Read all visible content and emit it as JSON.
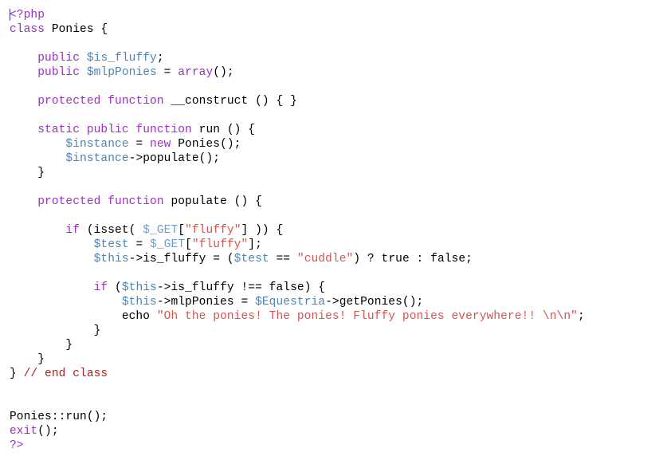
{
  "editor": {
    "language": "PHP",
    "caret_visible": true,
    "background_color": "#ffffff",
    "foreground_color": "#000000"
  },
  "theme": {
    "keyword": "#9B30C0",
    "variable": "#4E84B4",
    "superglobal": "#6E9FCC",
    "string": "#D9534F",
    "comment": "#B0201E",
    "plain": "#000000"
  },
  "code": {
    "lines": [
      {
        "indent": 0,
        "tokens": [
          {
            "t": "<?php",
            "c": "tag"
          }
        ]
      },
      {
        "indent": 0,
        "tokens": [
          {
            "t": "class",
            "c": "kw"
          },
          {
            "t": " Ponies {",
            "c": "plain"
          }
        ]
      },
      {
        "indent": 0,
        "tokens": []
      },
      {
        "indent": 1,
        "tokens": [
          {
            "t": "public",
            "c": "kw"
          },
          {
            "t": " ",
            "c": "plain"
          },
          {
            "t": "$is_fluffy",
            "c": "var"
          },
          {
            "t": ";",
            "c": "plain"
          }
        ]
      },
      {
        "indent": 1,
        "tokens": [
          {
            "t": "public",
            "c": "kw"
          },
          {
            "t": " ",
            "c": "plain"
          },
          {
            "t": "$mlpPonies",
            "c": "var"
          },
          {
            "t": " = ",
            "c": "plain"
          },
          {
            "t": "array",
            "c": "kw"
          },
          {
            "t": "();",
            "c": "plain"
          }
        ]
      },
      {
        "indent": 0,
        "tokens": []
      },
      {
        "indent": 1,
        "tokens": [
          {
            "t": "protected function",
            "c": "kw"
          },
          {
            "t": " __construct () { }",
            "c": "plain"
          }
        ]
      },
      {
        "indent": 0,
        "tokens": []
      },
      {
        "indent": 1,
        "tokens": [
          {
            "t": "static public function",
            "c": "kw"
          },
          {
            "t": " run () {",
            "c": "plain"
          }
        ]
      },
      {
        "indent": 2,
        "tokens": [
          {
            "t": "$instance",
            "c": "var"
          },
          {
            "t": " = ",
            "c": "plain"
          },
          {
            "t": "new",
            "c": "kw"
          },
          {
            "t": " Ponies();",
            "c": "plain"
          }
        ]
      },
      {
        "indent": 2,
        "tokens": [
          {
            "t": "$instance",
            "c": "var"
          },
          {
            "t": "->populate();",
            "c": "plain"
          }
        ]
      },
      {
        "indent": 1,
        "tokens": [
          {
            "t": "}",
            "c": "plain"
          }
        ]
      },
      {
        "indent": 0,
        "tokens": []
      },
      {
        "indent": 1,
        "tokens": [
          {
            "t": "protected function",
            "c": "kw"
          },
          {
            "t": " populate () {",
            "c": "plain"
          }
        ]
      },
      {
        "indent": 0,
        "tokens": []
      },
      {
        "indent": 2,
        "tokens": [
          {
            "t": "if",
            "c": "kw"
          },
          {
            "t": " (isset( ",
            "c": "plain"
          },
          {
            "t": "$_GET",
            "c": "svar"
          },
          {
            "t": "[",
            "c": "plain"
          },
          {
            "t": "\"fluffy\"",
            "c": "str"
          },
          {
            "t": "] )) {",
            "c": "plain"
          }
        ]
      },
      {
        "indent": 3,
        "tokens": [
          {
            "t": "$test",
            "c": "var"
          },
          {
            "t": " = ",
            "c": "plain"
          },
          {
            "t": "$_GET",
            "c": "svar"
          },
          {
            "t": "[",
            "c": "plain"
          },
          {
            "t": "\"fluffy\"",
            "c": "str"
          },
          {
            "t": "];",
            "c": "plain"
          }
        ]
      },
      {
        "indent": 3,
        "tokens": [
          {
            "t": "$this",
            "c": "var"
          },
          {
            "t": "->is_fluffy = (",
            "c": "plain"
          },
          {
            "t": "$test",
            "c": "var"
          },
          {
            "t": " == ",
            "c": "plain"
          },
          {
            "t": "\"cuddle\"",
            "c": "str"
          },
          {
            "t": ") ? true : false;",
            "c": "plain"
          }
        ]
      },
      {
        "indent": 0,
        "tokens": []
      },
      {
        "indent": 3,
        "tokens": [
          {
            "t": "if",
            "c": "kw"
          },
          {
            "t": " (",
            "c": "plain"
          },
          {
            "t": "$this",
            "c": "var"
          },
          {
            "t": "->is_fluffy !== false) {",
            "c": "plain"
          }
        ]
      },
      {
        "indent": 4,
        "tokens": [
          {
            "t": "$this",
            "c": "var"
          },
          {
            "t": "->mlpPonies = ",
            "c": "plain"
          },
          {
            "t": "$Equestria",
            "c": "var"
          },
          {
            "t": "->getPonies();",
            "c": "plain"
          }
        ]
      },
      {
        "indent": 4,
        "tokens": [
          {
            "t": "echo ",
            "c": "plain"
          },
          {
            "t": "\"Oh the ponies! The ponies! Fluffy ponies everywhere!! \\n\\n\"",
            "c": "str"
          },
          {
            "t": ";",
            "c": "plain"
          }
        ]
      },
      {
        "indent": 3,
        "tokens": [
          {
            "t": "}",
            "c": "plain"
          }
        ]
      },
      {
        "indent": 2,
        "tokens": [
          {
            "t": "}",
            "c": "plain"
          }
        ]
      },
      {
        "indent": 1,
        "tokens": [
          {
            "t": "}",
            "c": "plain"
          }
        ]
      },
      {
        "indent": 0,
        "tokens": [
          {
            "t": "} ",
            "c": "plain"
          },
          {
            "t": "// end class",
            "c": "com"
          }
        ]
      },
      {
        "indent": 0,
        "tokens": []
      },
      {
        "indent": 0,
        "tokens": []
      },
      {
        "indent": 0,
        "tokens": [
          {
            "t": "Ponies::run();",
            "c": "plain"
          }
        ]
      },
      {
        "indent": 0,
        "tokens": [
          {
            "t": "exit",
            "c": "kw"
          },
          {
            "t": "();",
            "c": "plain"
          }
        ]
      },
      {
        "indent": 0,
        "tokens": [
          {
            "t": "?>",
            "c": "tag"
          }
        ]
      }
    ]
  }
}
